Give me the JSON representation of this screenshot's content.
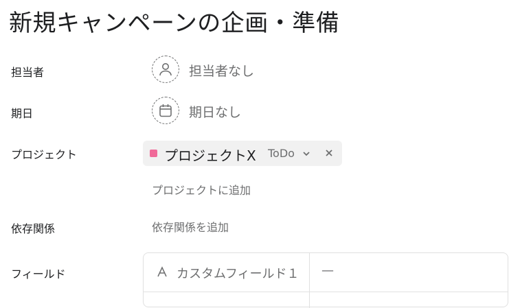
{
  "task": {
    "title": "新規キャンペーンの企画・準備"
  },
  "rows": {
    "assignee": {
      "label": "担当者",
      "value": "担当者なし",
      "icon": "user-icon"
    },
    "due_date": {
      "label": "期日",
      "value": "期日なし",
      "icon": "calendar-icon"
    },
    "projects": {
      "label": "プロジェクト",
      "project": {
        "name": "プロジェクトX",
        "status": "ToDo",
        "color": "#f06a99"
      },
      "add_link": "プロジェクトに追加"
    },
    "dependencies": {
      "label": "依存関係",
      "add_link": "依存関係を追加"
    },
    "fields": {
      "label": "フィールド",
      "items": [
        {
          "name": "カスタムフィールド１",
          "value": "—",
          "icon": "text-field-icon"
        }
      ]
    }
  }
}
